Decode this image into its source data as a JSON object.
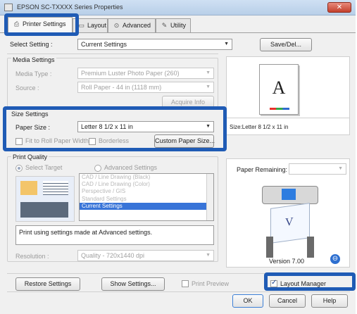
{
  "window": {
    "title": "EPSON SC-TXXXX Series Properties",
    "close_glyph": "✕"
  },
  "tabs": [
    {
      "label": "Printer Settings",
      "icon": "printer-icon",
      "glyph": "⎙"
    },
    {
      "label": "Layout",
      "icon": "layout-icon",
      "glyph": "▭"
    },
    {
      "label": "Advanced",
      "icon": "advanced-icon",
      "glyph": "⊙"
    },
    {
      "label": "Utility",
      "icon": "utility-icon",
      "glyph": "✎"
    }
  ],
  "select_setting": {
    "label": "Select Setting :",
    "value": "Current Settings",
    "save_del_label": "Save/Del..."
  },
  "media_settings": {
    "title": "Media Settings",
    "media_type_label": "Media Type :",
    "media_type_value": "Premium Luster Photo Paper (260)",
    "source_label": "Source :",
    "source_value": "Roll Paper - 44 in (1118 mm)",
    "acquire_info_label": "Acquire Info"
  },
  "size_settings": {
    "title": "Size Settings",
    "paper_size_label": "Paper Size :",
    "paper_size_value": "Letter 8 1/2 x 11 in",
    "fit_roll_label": "Fit to Roll Paper Width",
    "borderless_label": "Borderless",
    "custom_paper_label": "Custom Paper Size..."
  },
  "print_quality": {
    "title": "Print Quality",
    "select_target_label": "Select Target",
    "advanced_settings_label": "Advanced Settings",
    "targets": [
      "CAD / Line Drawing (Black)",
      "CAD / Line Drawing (Color)",
      "Perspective / GIS",
      "Standard Settings",
      "Current Settings"
    ],
    "selected_target": "Current Settings",
    "description": "Print using settings made at Advanced settings.",
    "resolution_label": "Resolution :",
    "resolution_value": "Quality - 720x1440 dpi"
  },
  "preview": {
    "letter": "A",
    "size_text": "Size:Letter 8 1/2 x 11 in",
    "paper_remaining_label": "Paper Remaining:",
    "version": "Version 7.00"
  },
  "bottom": {
    "restore_label": "Restore Settings",
    "show_settings_label": "Show Settings...",
    "print_preview_label": "Print Preview",
    "layout_manager_label": "Layout Manager",
    "ok_label": "OK",
    "cancel_label": "Cancel",
    "help_label": "Help"
  },
  "colors": {
    "highlight": "#1f5bb5",
    "selection": "#3874d8"
  }
}
